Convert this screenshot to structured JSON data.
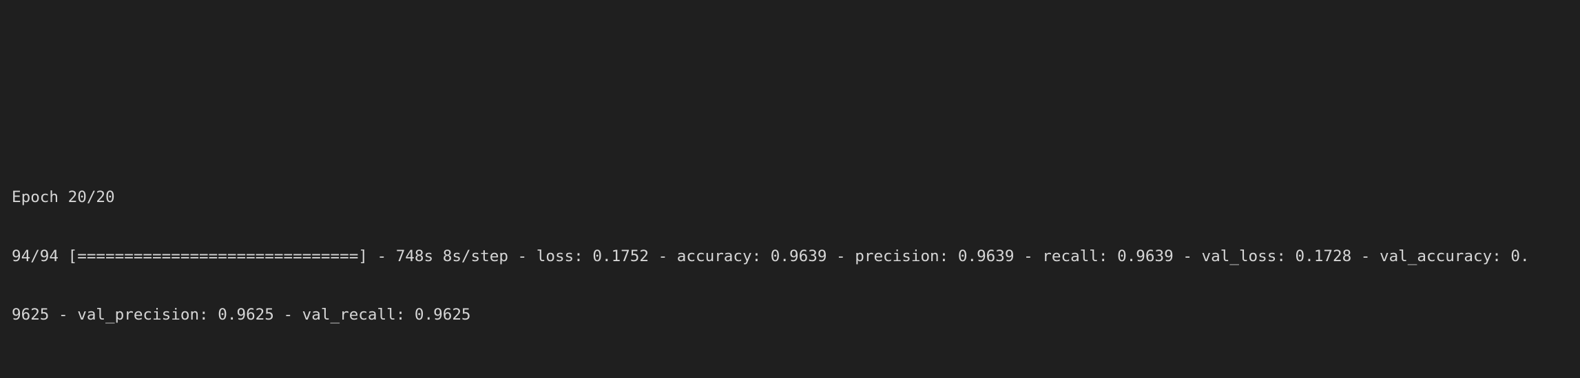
{
  "terminal": {
    "lines": [
      "Epoch 20/20",
      "94/94 [==============================] - 748s 8s/step - loss: 0.1752 - accuracy: 0.9639 - precision: 0.9639 - recall: 0.9639 - val_loss: 0.1728 - val_accuracy: 0.",
      "9625 - val_precision: 0.9625 - val_recall: 0.9625"
    ]
  },
  "colors": {
    "background": "#1f1f1f",
    "text": "#d6d6d6"
  }
}
